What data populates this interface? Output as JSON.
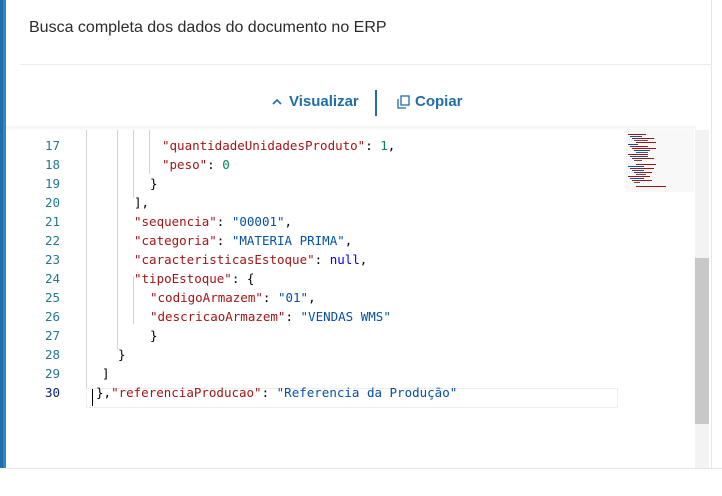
{
  "panel": {
    "title": "Busca completa dos dados do documento no ERP"
  },
  "toolbar": {
    "visualizar_label": "Visualizar",
    "copiar_label": "Copiar",
    "visualizar_icon": "chevron-up-icon",
    "copiar_icon": "copy-icon"
  },
  "editor": {
    "lines": [
      {
        "num": "17",
        "tokens": [
          [
            "key",
            "\"quantidadeUnidadesProduto\""
          ],
          [
            "p",
            ": "
          ],
          [
            "num",
            "1"
          ],
          [
            "p",
            ","
          ]
        ]
      },
      {
        "num": "18",
        "tokens": [
          [
            "key",
            "\"peso\""
          ],
          [
            "p",
            ": "
          ],
          [
            "num",
            "0"
          ]
        ]
      },
      {
        "num": "19",
        "tokens": [
          [
            "p",
            "}"
          ]
        ]
      },
      {
        "num": "20",
        "tokens": [
          [
            "p",
            "],"
          ]
        ]
      },
      {
        "num": "21",
        "tokens": [
          [
            "key",
            "\"sequencia\""
          ],
          [
            "p",
            ": "
          ],
          [
            "str",
            "\"00001\""
          ],
          [
            "p",
            ","
          ]
        ]
      },
      {
        "num": "22",
        "tokens": [
          [
            "key",
            "\"categoria\""
          ],
          [
            "p",
            ": "
          ],
          [
            "str",
            "\"MATERIA PRIMA\""
          ],
          [
            "p",
            ","
          ]
        ]
      },
      {
        "num": "23",
        "tokens": [
          [
            "key",
            "\"caracteristicasEstoque\""
          ],
          [
            "p",
            ": "
          ],
          [
            "kw",
            "null"
          ],
          [
            "p",
            ","
          ]
        ]
      },
      {
        "num": "24",
        "tokens": [
          [
            "key",
            "\"tipoEstoque\""
          ],
          [
            "p",
            ": {"
          ]
        ]
      },
      {
        "num": "25",
        "tokens": [
          [
            "key",
            "\"codigoArmazem\""
          ],
          [
            "p",
            ": "
          ],
          [
            "str",
            "\"01\""
          ],
          [
            "p",
            ","
          ]
        ]
      },
      {
        "num": "26",
        "tokens": [
          [
            "key",
            "\"descricaoArmazem\""
          ],
          [
            "p",
            ": "
          ],
          [
            "str",
            "\"VENDAS WMS\""
          ]
        ]
      },
      {
        "num": "27",
        "tokens": [
          [
            "p",
            "}"
          ]
        ]
      },
      {
        "num": "28",
        "tokens": [
          [
            "p",
            "}"
          ]
        ]
      },
      {
        "num": "29",
        "tokens": [
          [
            "p",
            "]"
          ]
        ]
      },
      {
        "num": "30",
        "tokens": [
          [
            "p",
            "},"
          ],
          [
            "key",
            "\"referenciaProducao\""
          ],
          [
            "p",
            ": "
          ],
          [
            "str",
            "\"Referencia da Produção\""
          ]
        ]
      }
    ]
  },
  "colors": {
    "accent": "#1f6ea8",
    "key": "#a31515",
    "string": "#0451a5",
    "number": "#098658",
    "keyword": "#0000ff",
    "line_number": "#237893"
  }
}
